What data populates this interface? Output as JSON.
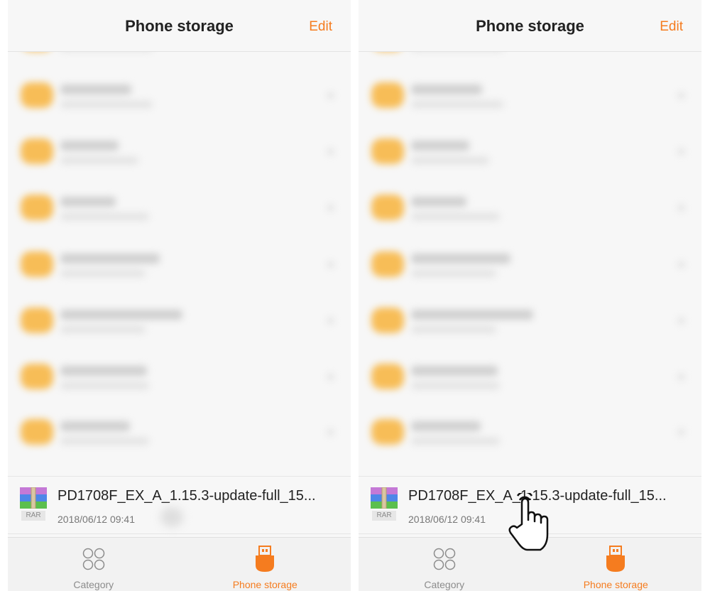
{
  "accent_color": "#f57c1f",
  "panels": [
    {
      "header": {
        "title": "Phone storage",
        "edit_label": "Edit"
      },
      "file": {
        "name": "PD1708F_EX_A_1.15.3-update-full_15...",
        "date": "2018/06/12 09:41",
        "type_label": "RAR",
        "icon": "rar-archive-icon"
      },
      "tabs": [
        {
          "label": "Category",
          "icon": "category-icon",
          "active": false
        },
        {
          "label": "Phone storage",
          "icon": "usb-storage-icon",
          "active": true
        }
      ]
    },
    {
      "header": {
        "title": "Phone storage",
        "edit_label": "Edit"
      },
      "file": {
        "name": "PD1708F_EX_A_1.15.3-update-full_15...",
        "date": "2018/06/12 09:41",
        "type_label": "RAR",
        "icon": "rar-archive-icon"
      },
      "tabs": [
        {
          "label": "Category",
          "icon": "category-icon",
          "active": false
        },
        {
          "label": "Phone storage",
          "icon": "usb-storage-icon",
          "active": true
        }
      ],
      "overlay": {
        "icon": "tap-hand-icon"
      }
    }
  ]
}
